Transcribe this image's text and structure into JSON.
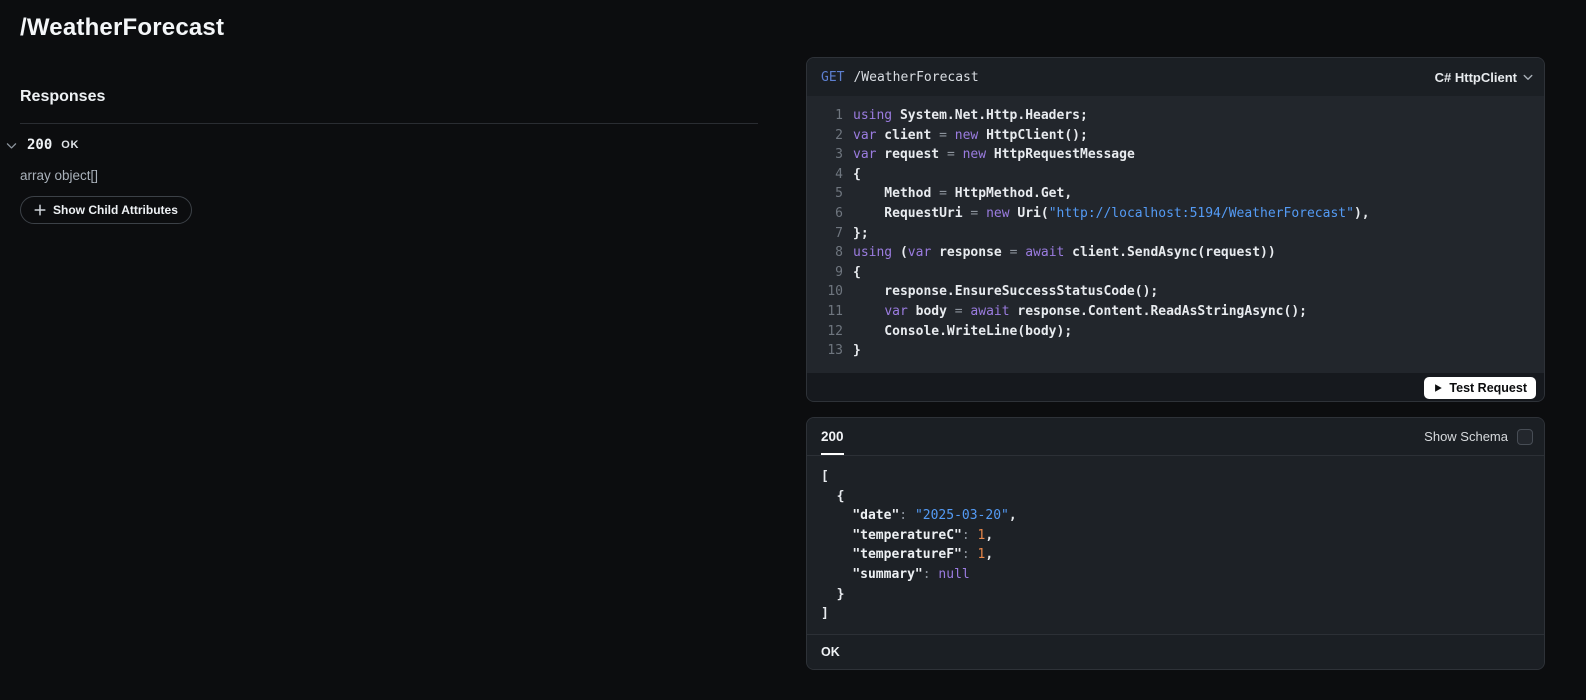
{
  "page": {
    "title": "/WeatherForecast"
  },
  "left_panel": {
    "responses_heading": "Responses",
    "response_item": {
      "code": "200",
      "label": "OK",
      "type": "array object[]",
      "show_child_attributes_label": "Show Child Attributes"
    }
  },
  "request_panel": {
    "method": "GET",
    "path": "/WeatherForecast",
    "language_selector": "C# HttpClient",
    "test_request_label": "Test Request",
    "code_lines": [
      {
        "n": "1",
        "t": [
          [
            "kw",
            "using"
          ],
          [
            "pl",
            " System.Net.Http.Headers;"
          ]
        ]
      },
      {
        "n": "2",
        "t": [
          [
            "kw",
            "var"
          ],
          [
            "pl",
            " client "
          ],
          [
            "op",
            "="
          ],
          [
            "pl",
            " "
          ],
          [
            "kw",
            "new"
          ],
          [
            "pl",
            " HttpClient();"
          ]
        ]
      },
      {
        "n": "3",
        "t": [
          [
            "kw",
            "var"
          ],
          [
            "pl",
            " request "
          ],
          [
            "op",
            "="
          ],
          [
            "pl",
            " "
          ],
          [
            "kw",
            "new"
          ],
          [
            "pl",
            " HttpRequestMessage"
          ]
        ]
      },
      {
        "n": "4",
        "t": [
          [
            "pl",
            "{"
          ]
        ]
      },
      {
        "n": "5",
        "t": [
          [
            "pl",
            "    Method "
          ],
          [
            "op",
            "="
          ],
          [
            "pl",
            " HttpMethod.Get,"
          ]
        ]
      },
      {
        "n": "6",
        "t": [
          [
            "pl",
            "    RequestUri "
          ],
          [
            "op",
            "="
          ],
          [
            "pl",
            " "
          ],
          [
            "kw",
            "new"
          ],
          [
            "pl",
            " Uri("
          ],
          [
            "str",
            "\"http://localhost:5194/WeatherForecast\""
          ],
          [
            "pl",
            "),"
          ]
        ]
      },
      {
        "n": "7",
        "t": [
          [
            "pl",
            "};"
          ]
        ]
      },
      {
        "n": "8",
        "t": [
          [
            "kw",
            "using"
          ],
          [
            "pl",
            " ("
          ],
          [
            "kw",
            "var"
          ],
          [
            "pl",
            " response "
          ],
          [
            "op",
            "="
          ],
          [
            "pl",
            " "
          ],
          [
            "kw",
            "await"
          ],
          [
            "pl",
            " client.SendAsync(request))"
          ]
        ]
      },
      {
        "n": "9",
        "t": [
          [
            "pl",
            "{"
          ]
        ]
      },
      {
        "n": "10",
        "t": [
          [
            "pl",
            "    response.EnsureSuccessStatusCode();"
          ]
        ]
      },
      {
        "n": "11",
        "t": [
          [
            "pl",
            "    "
          ],
          [
            "kw",
            "var"
          ],
          [
            "pl",
            " body "
          ],
          [
            "op",
            "="
          ],
          [
            "pl",
            " "
          ],
          [
            "kw",
            "await"
          ],
          [
            "pl",
            " response.Content.ReadAsStringAsync();"
          ]
        ]
      },
      {
        "n": "12",
        "t": [
          [
            "pl",
            "    Console.WriteLine(body);"
          ]
        ]
      },
      {
        "n": "13",
        "t": [
          [
            "pl",
            "}"
          ]
        ]
      }
    ]
  },
  "response_panel": {
    "active_tab": "200",
    "show_schema_label": "Show Schema",
    "schema_checkbox_checked": false,
    "footer_status": "OK",
    "json_lines": [
      {
        "t": [
          [
            "pl",
            "["
          ]
        ]
      },
      {
        "t": [
          [
            "pl",
            "  {"
          ]
        ]
      },
      {
        "t": [
          [
            "pl",
            "    "
          ],
          [
            "key",
            "\"date\""
          ],
          [
            "op",
            ": "
          ],
          [
            "str",
            "\"2025-03-20\""
          ],
          [
            "pl",
            ","
          ]
        ]
      },
      {
        "t": [
          [
            "pl",
            "    "
          ],
          [
            "key",
            "\"temperatureC\""
          ],
          [
            "op",
            ": "
          ],
          [
            "num",
            "1"
          ],
          [
            "pl",
            ","
          ]
        ]
      },
      {
        "t": [
          [
            "pl",
            "    "
          ],
          [
            "key",
            "\"temperatureF\""
          ],
          [
            "op",
            ": "
          ],
          [
            "num",
            "1"
          ],
          [
            "pl",
            ","
          ]
        ]
      },
      {
        "t": [
          [
            "pl",
            "    "
          ],
          [
            "key",
            "\"summary\""
          ],
          [
            "op",
            ": "
          ],
          [
            "nul",
            "null"
          ]
        ]
      },
      {
        "t": [
          [
            "pl",
            "  }"
          ]
        ]
      },
      {
        "t": [
          [
            "pl",
            "]"
          ]
        ]
      }
    ]
  },
  "colors": {
    "background": "#0c0d0f",
    "method_get": "#5d7fd0",
    "keyword": "#9b7ce0",
    "string": "#549bf5",
    "number": "#e8874a",
    "null": "#9b7ce0",
    "panel_header": "#1b1f24",
    "code_background": "#22262c"
  }
}
